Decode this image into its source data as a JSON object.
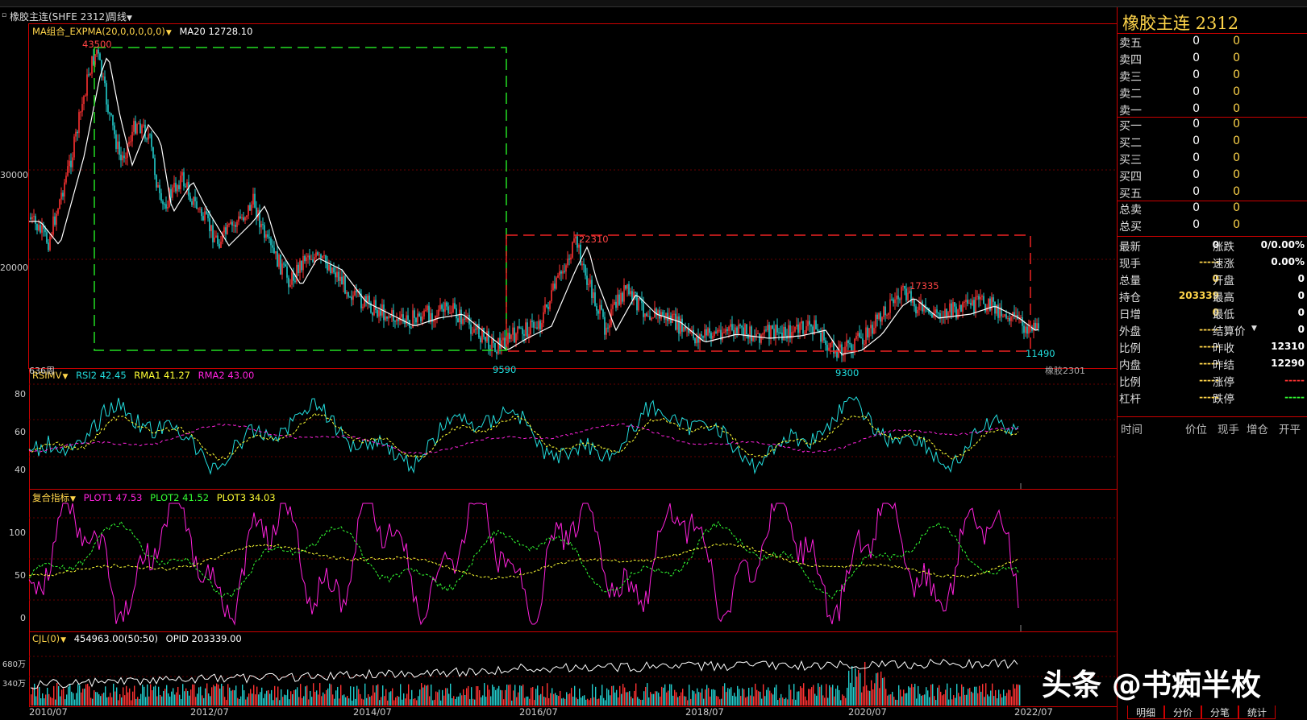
{
  "title": {
    "symbol": "橡胶主连(SHFE 2312)",
    "period": "周线"
  },
  "main_panel": {
    "indicator": "MA组合_EXPMA(20,0,0,0,0,0)",
    "ma20": "MA20 12728.10",
    "y_ticks": [
      "30000",
      "20000"
    ],
    "bars_label": "636周",
    "contract_label": "橡胶2301",
    "annotations": {
      "high1": "43500",
      "low1": "9590",
      "high2": "22310",
      "low2": "9300",
      "high3": "17335",
      "last": "11490"
    }
  },
  "rsi_panel": {
    "name": "RSIMV",
    "rsi2": "RSI2 42.45",
    "rma1": "RMA1 41.27",
    "rma2": "RMA2 43.00",
    "y_ticks": [
      "80",
      "60",
      "40"
    ]
  },
  "composite_panel": {
    "name": "复合指标",
    "plot1": "PLOT1 47.53",
    "plot2": "PLOT2 41.52",
    "plot3": "PLOT3 34.03",
    "y_ticks": [
      "100",
      "50",
      "0"
    ]
  },
  "volume_panel": {
    "name": "CJL(0)",
    "value": "454963.00(50:50)",
    "opid": "OPID 203339.00",
    "y_ticks": [
      "680万",
      "340万"
    ]
  },
  "x_axis": [
    "2010/07",
    "2012/07",
    "2014/07",
    "2016/07",
    "2018/07",
    "2020/07",
    "2022/07"
  ],
  "quote": {
    "title": "橡胶主连  2312",
    "sells": [
      {
        "label": "卖五",
        "price": "0",
        "vol": "0"
      },
      {
        "label": "卖四",
        "price": "0",
        "vol": "0"
      },
      {
        "label": "卖三",
        "price": "0",
        "vol": "0"
      },
      {
        "label": "卖二",
        "price": "0",
        "vol": "0"
      },
      {
        "label": "卖一",
        "price": "0",
        "vol": "0"
      }
    ],
    "buys": [
      {
        "label": "买一",
        "price": "0",
        "vol": "0"
      },
      {
        "label": "买二",
        "price": "0",
        "vol": "0"
      },
      {
        "label": "买三",
        "price": "0",
        "vol": "0"
      },
      {
        "label": "买四",
        "price": "0",
        "vol": "0"
      },
      {
        "label": "买五",
        "price": "0",
        "vol": "0"
      }
    ],
    "totals": [
      {
        "label": "总卖",
        "price": "0",
        "vol": "0"
      },
      {
        "label": "总买",
        "price": "0",
        "vol": "0"
      }
    ],
    "stats": [
      {
        "la": "最新",
        "va": "0",
        "lb": "涨跌",
        "vb": "0/0.00%"
      },
      {
        "la": "现手",
        "va": "-----",
        "lb": "速涨",
        "vb": "0.00%"
      },
      {
        "la": "总量",
        "va": "0",
        "lb": "开盘",
        "vb": "0"
      },
      {
        "la": "持仓",
        "va": "203339",
        "lb": "最高",
        "vb": "0"
      },
      {
        "la": "日增",
        "va": "0",
        "lb": "最低",
        "vb": "0"
      },
      {
        "la": "外盘",
        "va": "-----",
        "lb": "结算价",
        "vb": "0"
      },
      {
        "la": "比例",
        "va": "-----",
        "lb": "昨收",
        "vb": "12310"
      },
      {
        "la": "内盘",
        "va": "-----",
        "lb": "昨结",
        "vb": "12290"
      },
      {
        "la": "比例",
        "va": "-----",
        "lb": "涨停",
        "vb": "-----"
      },
      {
        "la": "杠杆",
        "va": "-----",
        "lb": "跌停",
        "vb": "-----"
      }
    ],
    "tick_header": [
      "时间",
      "价位",
      "现手",
      "增仓",
      "开平"
    ]
  },
  "tabs": [
    "明细",
    "分价",
    "分笔",
    "统计"
  ],
  "watermark": "头条 @书痴半枚",
  "colors": {
    "frame": "#cc0000",
    "up": "#ff3333",
    "down": "#22cccc",
    "ma": "#ffffff",
    "box_green": "#22dd22",
    "box_red": "#ee2222",
    "magenta": "#ff22dd",
    "yellow": "#ffff33",
    "green": "#33ff33"
  }
}
